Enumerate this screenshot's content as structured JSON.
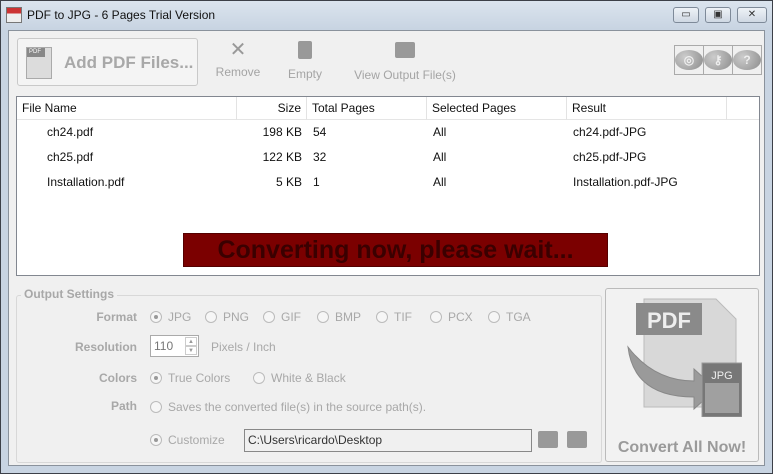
{
  "window": {
    "title": "PDF to JPG - 6 Pages Trial Version",
    "minimize": "▭",
    "maximize": "▣",
    "close": "✕"
  },
  "toolbar": {
    "add_label": "Add PDF Files...",
    "pdf_badge": "PDF",
    "remove_label": "Remove",
    "empty_label": "Empty",
    "view_label": "View Output File(s)",
    "help": "?"
  },
  "table": {
    "columns": [
      "File Name",
      "Size",
      "Total Pages",
      "Selected Pages",
      "Result"
    ],
    "rows": [
      {
        "name": "ch24.pdf",
        "size": "198 KB",
        "total": "54",
        "selected": "All",
        "result": "ch24.pdf-JPG"
      },
      {
        "name": "ch25.pdf",
        "size": "122 KB",
        "total": "32",
        "selected": "All",
        "result": "ch25.pdf-JPG"
      },
      {
        "name": "Installation.pdf",
        "size": "5 KB",
        "total": "1",
        "selected": "All",
        "result": "Installation.pdf-JPG"
      }
    ]
  },
  "status_banner": "Converting now, please wait...",
  "output": {
    "legend": "Output Settings",
    "format_label": "Format",
    "formats": [
      "JPG",
      "PNG",
      "GIF",
      "BMP",
      "TIF",
      "PCX",
      "TGA"
    ],
    "selected_format": "JPG",
    "resolution_label": "Resolution",
    "resolution": "110",
    "resolution_unit": "Pixels / Inch",
    "colors_label": "Colors",
    "color_options": [
      "True Colors",
      "White & Black"
    ],
    "selected_color": "True Colors",
    "path_label": "Path",
    "path_source": "Saves the converted file(s) in the source path(s).",
    "path_custom": "Customize",
    "path_value": "C:\\Users\\ricardo\\Desktop"
  },
  "convert": {
    "label": "Convert All Now!",
    "pdf": "PDF",
    "jpg": "JPG"
  }
}
